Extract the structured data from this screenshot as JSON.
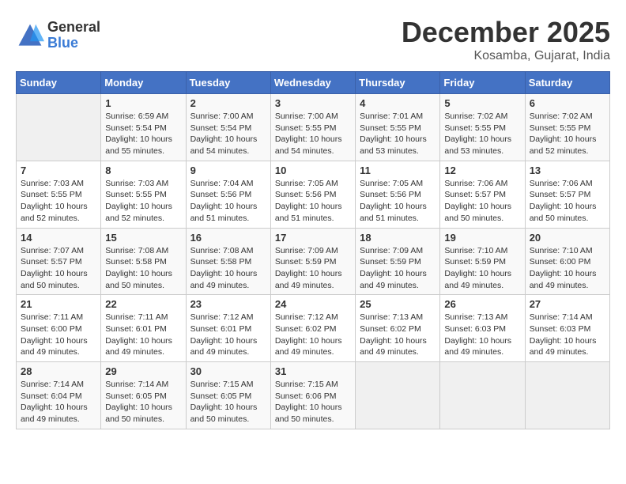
{
  "logo": {
    "general": "General",
    "blue": "Blue"
  },
  "title": "December 2025",
  "location": "Kosamba, Gujarat, India",
  "headers": [
    "Sunday",
    "Monday",
    "Tuesday",
    "Wednesday",
    "Thursday",
    "Friday",
    "Saturday"
  ],
  "weeks": [
    [
      {
        "day": "",
        "info": ""
      },
      {
        "day": "1",
        "info": "Sunrise: 6:59 AM\nSunset: 5:54 PM\nDaylight: 10 hours\nand 55 minutes."
      },
      {
        "day": "2",
        "info": "Sunrise: 7:00 AM\nSunset: 5:54 PM\nDaylight: 10 hours\nand 54 minutes."
      },
      {
        "day": "3",
        "info": "Sunrise: 7:00 AM\nSunset: 5:55 PM\nDaylight: 10 hours\nand 54 minutes."
      },
      {
        "day": "4",
        "info": "Sunrise: 7:01 AM\nSunset: 5:55 PM\nDaylight: 10 hours\nand 53 minutes."
      },
      {
        "day": "5",
        "info": "Sunrise: 7:02 AM\nSunset: 5:55 PM\nDaylight: 10 hours\nand 53 minutes."
      },
      {
        "day": "6",
        "info": "Sunrise: 7:02 AM\nSunset: 5:55 PM\nDaylight: 10 hours\nand 52 minutes."
      }
    ],
    [
      {
        "day": "7",
        "info": "Sunrise: 7:03 AM\nSunset: 5:55 PM\nDaylight: 10 hours\nand 52 minutes."
      },
      {
        "day": "8",
        "info": "Sunrise: 7:03 AM\nSunset: 5:55 PM\nDaylight: 10 hours\nand 52 minutes."
      },
      {
        "day": "9",
        "info": "Sunrise: 7:04 AM\nSunset: 5:56 PM\nDaylight: 10 hours\nand 51 minutes."
      },
      {
        "day": "10",
        "info": "Sunrise: 7:05 AM\nSunset: 5:56 PM\nDaylight: 10 hours\nand 51 minutes."
      },
      {
        "day": "11",
        "info": "Sunrise: 7:05 AM\nSunset: 5:56 PM\nDaylight: 10 hours\nand 51 minutes."
      },
      {
        "day": "12",
        "info": "Sunrise: 7:06 AM\nSunset: 5:57 PM\nDaylight: 10 hours\nand 50 minutes."
      },
      {
        "day": "13",
        "info": "Sunrise: 7:06 AM\nSunset: 5:57 PM\nDaylight: 10 hours\nand 50 minutes."
      }
    ],
    [
      {
        "day": "14",
        "info": "Sunrise: 7:07 AM\nSunset: 5:57 PM\nDaylight: 10 hours\nand 50 minutes."
      },
      {
        "day": "15",
        "info": "Sunrise: 7:08 AM\nSunset: 5:58 PM\nDaylight: 10 hours\nand 50 minutes."
      },
      {
        "day": "16",
        "info": "Sunrise: 7:08 AM\nSunset: 5:58 PM\nDaylight: 10 hours\nand 49 minutes."
      },
      {
        "day": "17",
        "info": "Sunrise: 7:09 AM\nSunset: 5:59 PM\nDaylight: 10 hours\nand 49 minutes."
      },
      {
        "day": "18",
        "info": "Sunrise: 7:09 AM\nSunset: 5:59 PM\nDaylight: 10 hours\nand 49 minutes."
      },
      {
        "day": "19",
        "info": "Sunrise: 7:10 AM\nSunset: 5:59 PM\nDaylight: 10 hours\nand 49 minutes."
      },
      {
        "day": "20",
        "info": "Sunrise: 7:10 AM\nSunset: 6:00 PM\nDaylight: 10 hours\nand 49 minutes."
      }
    ],
    [
      {
        "day": "21",
        "info": "Sunrise: 7:11 AM\nSunset: 6:00 PM\nDaylight: 10 hours\nand 49 minutes."
      },
      {
        "day": "22",
        "info": "Sunrise: 7:11 AM\nSunset: 6:01 PM\nDaylight: 10 hours\nand 49 minutes."
      },
      {
        "day": "23",
        "info": "Sunrise: 7:12 AM\nSunset: 6:01 PM\nDaylight: 10 hours\nand 49 minutes."
      },
      {
        "day": "24",
        "info": "Sunrise: 7:12 AM\nSunset: 6:02 PM\nDaylight: 10 hours\nand 49 minutes."
      },
      {
        "day": "25",
        "info": "Sunrise: 7:13 AM\nSunset: 6:02 PM\nDaylight: 10 hours\nand 49 minutes."
      },
      {
        "day": "26",
        "info": "Sunrise: 7:13 AM\nSunset: 6:03 PM\nDaylight: 10 hours\nand 49 minutes."
      },
      {
        "day": "27",
        "info": "Sunrise: 7:14 AM\nSunset: 6:03 PM\nDaylight: 10 hours\nand 49 minutes."
      }
    ],
    [
      {
        "day": "28",
        "info": "Sunrise: 7:14 AM\nSunset: 6:04 PM\nDaylight: 10 hours\nand 49 minutes."
      },
      {
        "day": "29",
        "info": "Sunrise: 7:14 AM\nSunset: 6:05 PM\nDaylight: 10 hours\nand 50 minutes."
      },
      {
        "day": "30",
        "info": "Sunrise: 7:15 AM\nSunset: 6:05 PM\nDaylight: 10 hours\nand 50 minutes."
      },
      {
        "day": "31",
        "info": "Sunrise: 7:15 AM\nSunset: 6:06 PM\nDaylight: 10 hours\nand 50 minutes."
      },
      {
        "day": "",
        "info": ""
      },
      {
        "day": "",
        "info": ""
      },
      {
        "day": "",
        "info": ""
      }
    ]
  ]
}
